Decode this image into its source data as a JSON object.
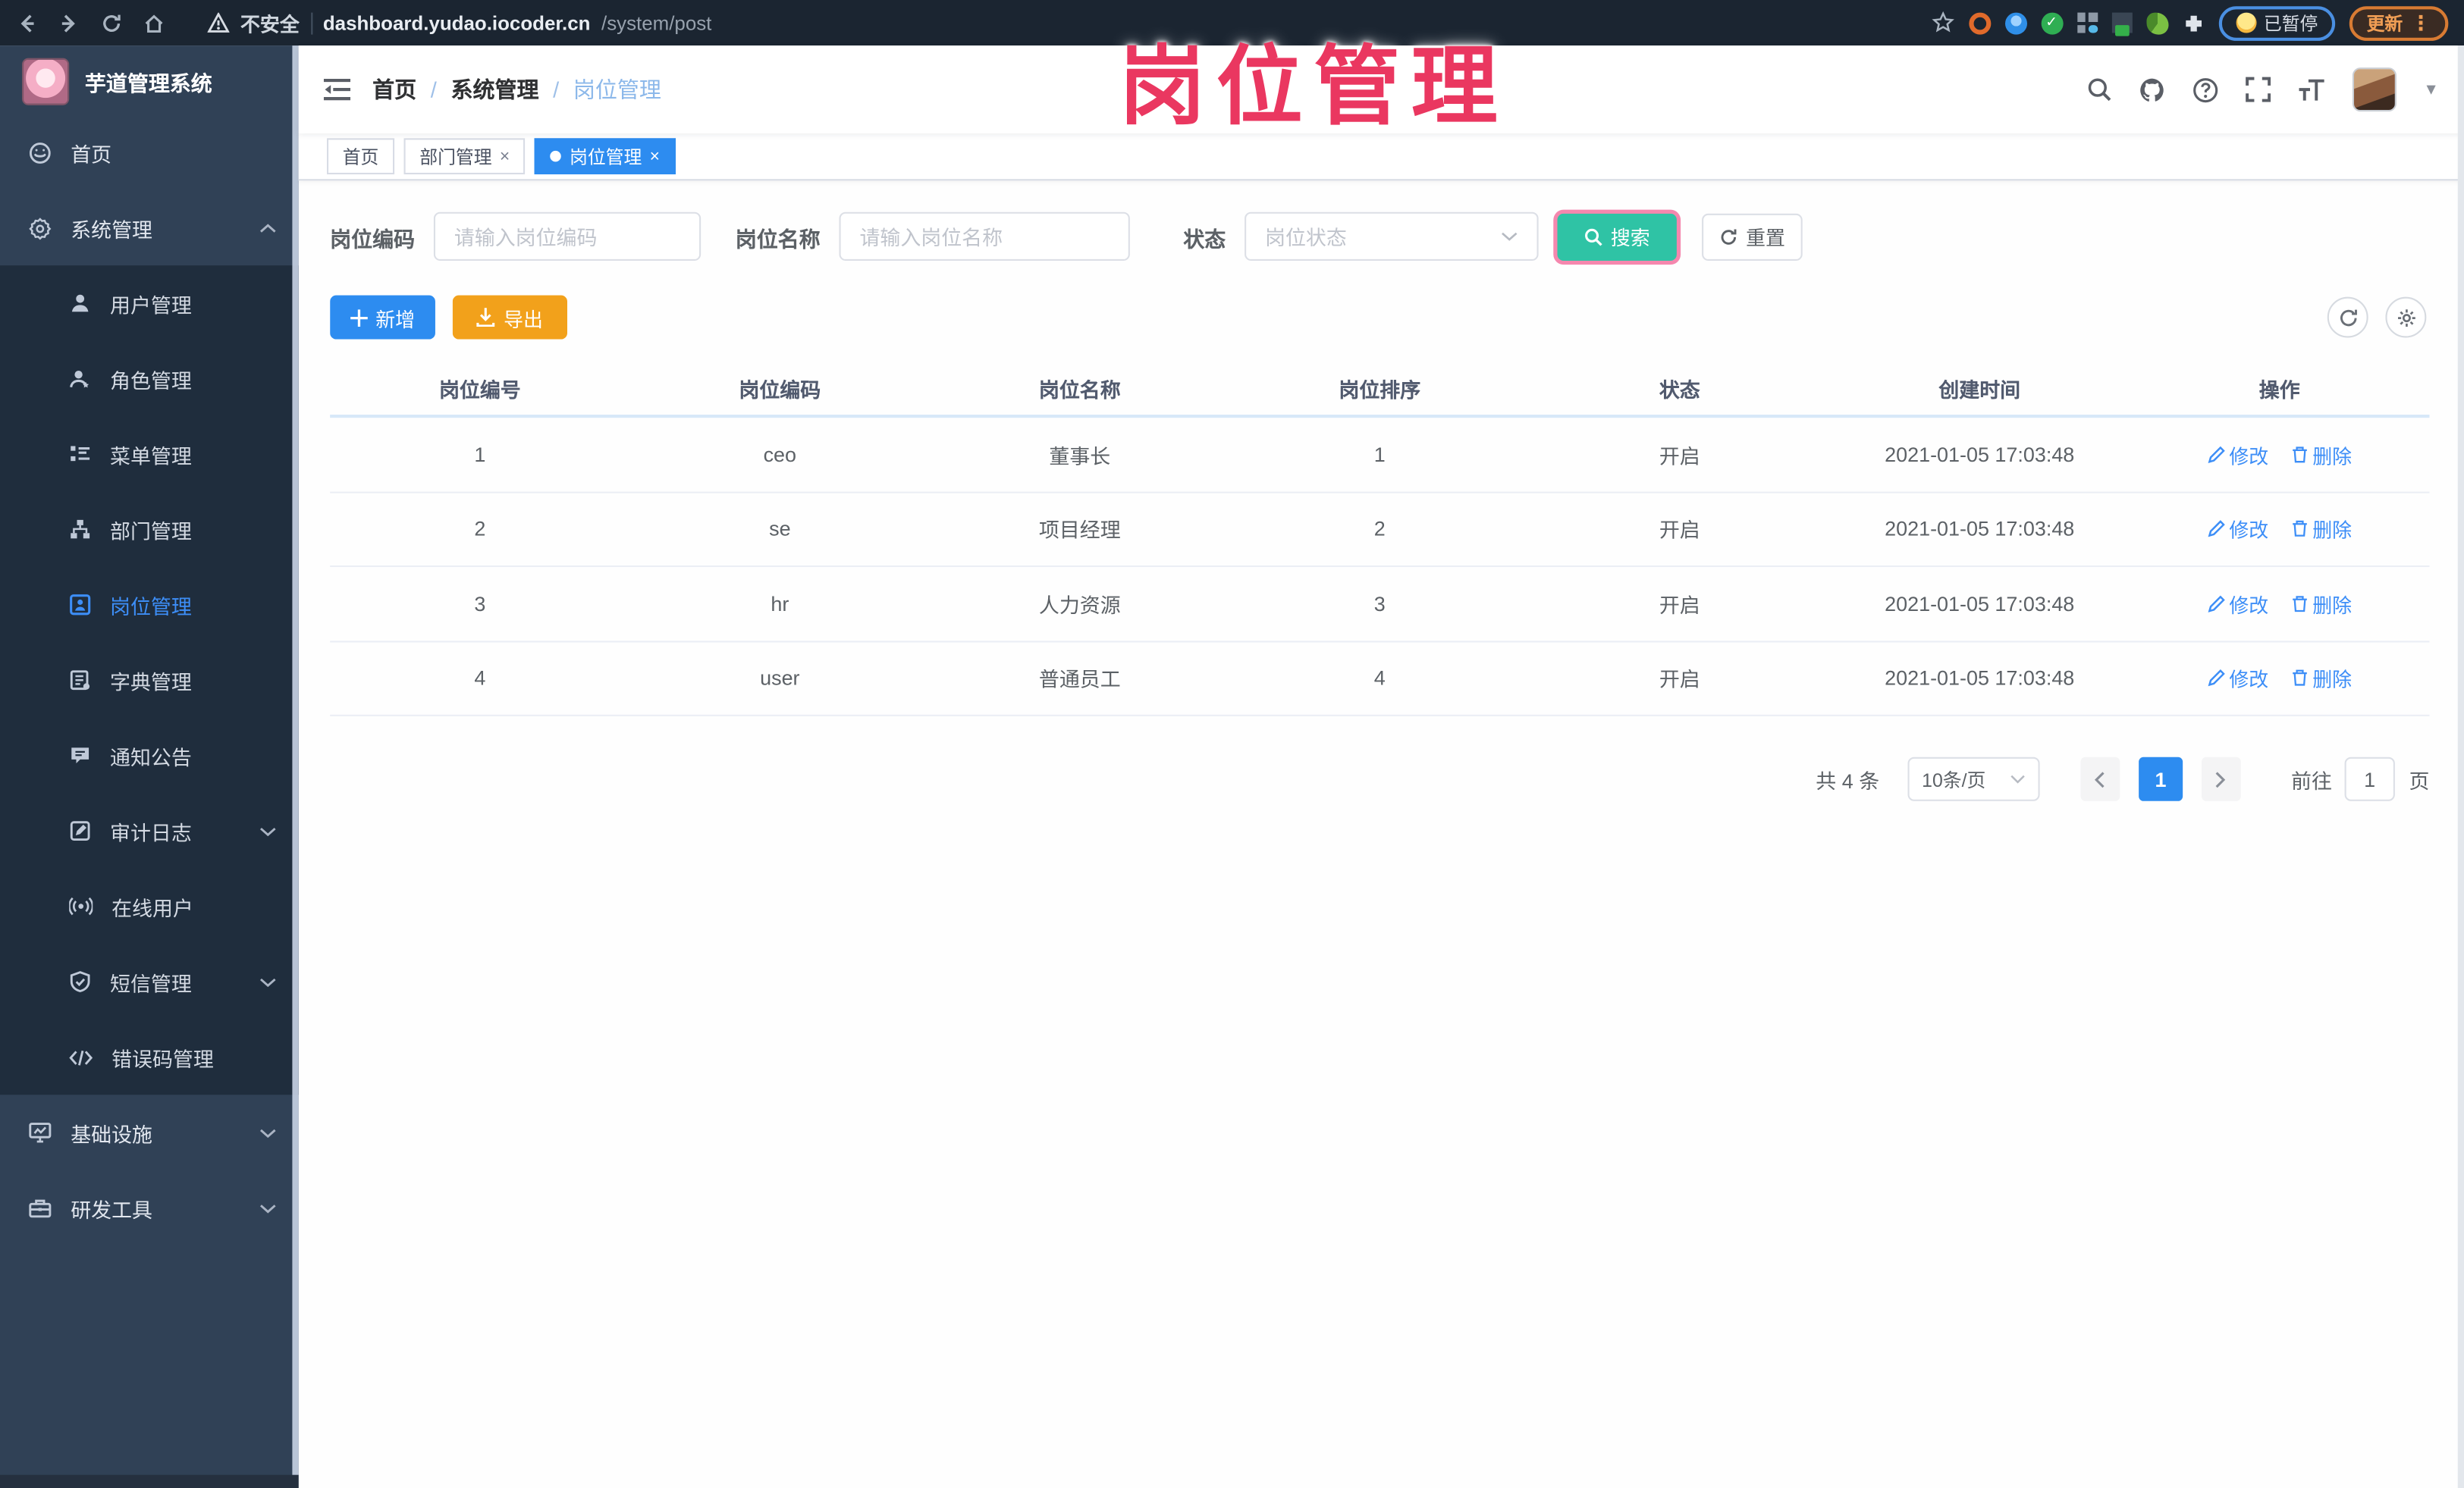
{
  "browser": {
    "security_label": "不安全",
    "url_host": "dashboard.yudao.iocoder.cn",
    "url_path": "/system/post",
    "paused_label": "已暂停",
    "update_label": "更新"
  },
  "watermark_text": "岗位管理",
  "sidebar": {
    "logo_title": "芋道管理系统",
    "items": [
      {
        "label": "首页"
      },
      {
        "label": "系统管理"
      },
      {
        "label": "用户管理"
      },
      {
        "label": "角色管理"
      },
      {
        "label": "菜单管理"
      },
      {
        "label": "部门管理"
      },
      {
        "label": "岗位管理"
      },
      {
        "label": "字典管理"
      },
      {
        "label": "通知公告"
      },
      {
        "label": "审计日志"
      },
      {
        "label": "在线用户"
      },
      {
        "label": "短信管理"
      },
      {
        "label": "错误码管理"
      },
      {
        "label": "基础设施"
      },
      {
        "label": "研发工具"
      }
    ]
  },
  "breadcrumb": {
    "home": "首页",
    "parent": "系统管理",
    "current": "岗位管理"
  },
  "tags": {
    "home": "首页",
    "dept": "部门管理",
    "post": "岗位管理"
  },
  "filters": {
    "code_label": "岗位编码",
    "code_placeholder": "请输入岗位编码",
    "name_label": "岗位名称",
    "name_placeholder": "请输入岗位名称",
    "status_label": "状态",
    "status_placeholder": "岗位状态",
    "search_label": "搜索",
    "reset_label": "重置"
  },
  "toolbar": {
    "add_label": "新增",
    "export_label": "导出"
  },
  "table": {
    "headers": [
      "岗位编号",
      "岗位编码",
      "岗位名称",
      "岗位排序",
      "状态",
      "创建时间",
      "操作"
    ],
    "edit_label": "修改",
    "delete_label": "删除",
    "rows": [
      {
        "id": "1",
        "code": "ceo",
        "name": "董事长",
        "sort": "1",
        "status": "开启",
        "created": "2021-01-05 17:03:48"
      },
      {
        "id": "2",
        "code": "se",
        "name": "项目经理",
        "sort": "2",
        "status": "开启",
        "created": "2021-01-05 17:03:48"
      },
      {
        "id": "3",
        "code": "hr",
        "name": "人力资源",
        "sort": "3",
        "status": "开启",
        "created": "2021-01-05 17:03:48"
      },
      {
        "id": "4",
        "code": "user",
        "name": "普通员工",
        "sort": "4",
        "status": "开启",
        "created": "2021-01-05 17:03:48"
      }
    ]
  },
  "pagination": {
    "total_text": "共 4 条",
    "page_size": "10条/页",
    "current_page": "1",
    "goto_label": "前往",
    "goto_value": "1",
    "page_unit": "页"
  }
}
